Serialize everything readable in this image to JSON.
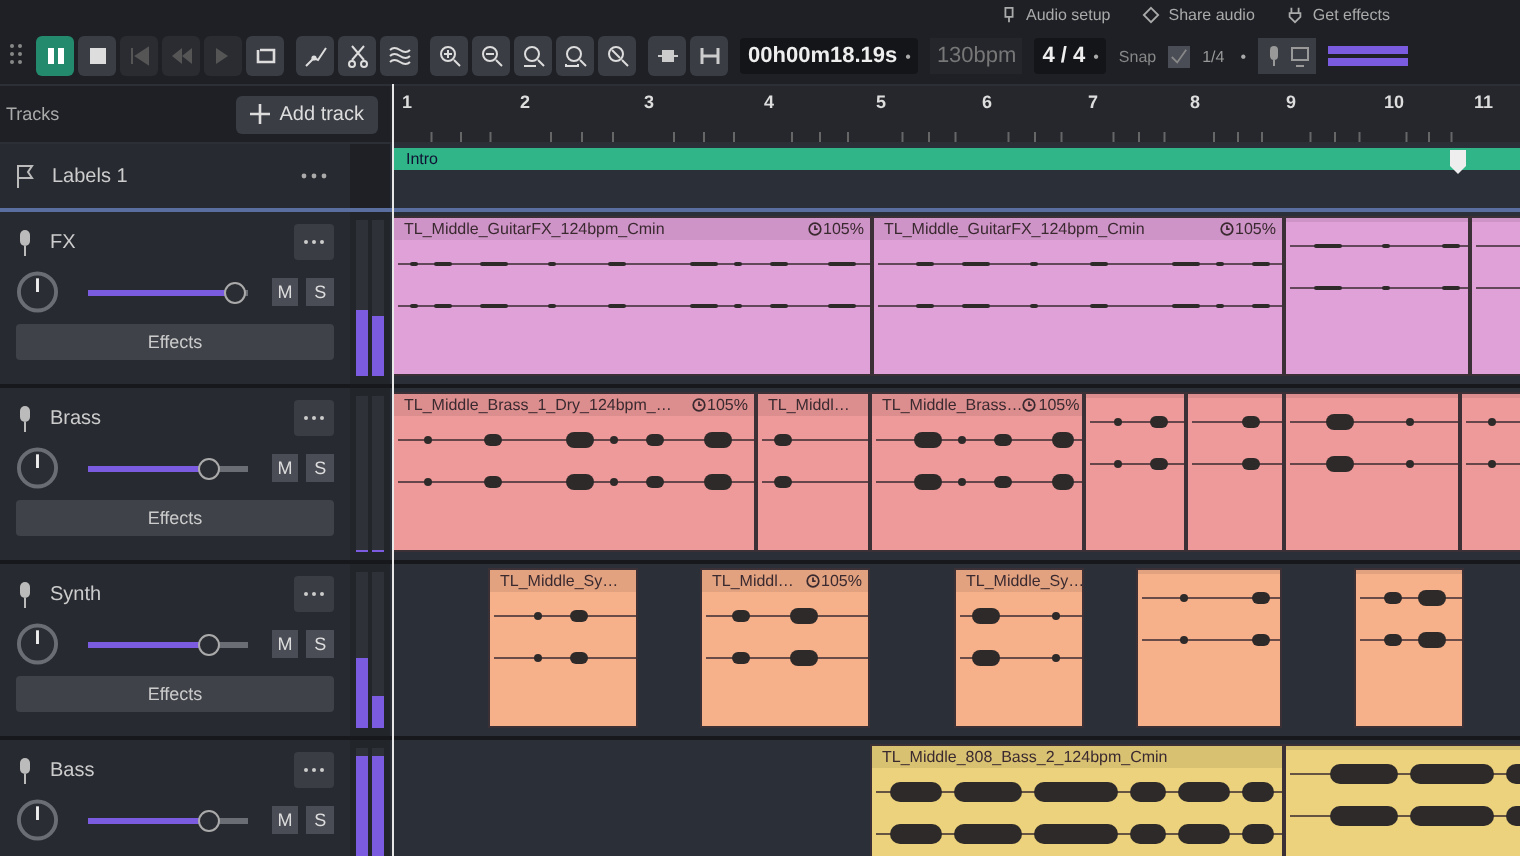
{
  "top_links": [
    {
      "kind": "setup",
      "label": "Audio setup"
    },
    {
      "kind": "share",
      "label": "Share audio"
    },
    {
      "kind": "effects",
      "label": "Get effects"
    }
  ],
  "transport": [
    {
      "kind": "pause",
      "selected": true,
      "disabled": false
    },
    {
      "kind": "stop",
      "selected": false,
      "disabled": false
    },
    {
      "kind": "rewind",
      "selected": false,
      "disabled": true
    },
    {
      "kind": "back",
      "selected": false,
      "disabled": true
    },
    {
      "kind": "forward",
      "selected": false,
      "disabled": true
    },
    {
      "kind": "loop",
      "selected": false,
      "disabled": false
    }
  ],
  "edit_tools": [
    {
      "kind": "envelope"
    },
    {
      "kind": "cut"
    },
    {
      "kind": "silence"
    }
  ],
  "zoom_tools": [
    {
      "kind": "zoom-in"
    },
    {
      "kind": "zoom-out"
    },
    {
      "kind": "zoom-fit"
    },
    {
      "kind": "zoom-selection"
    },
    {
      "kind": "zoom-toggle"
    }
  ],
  "trim_tools": [
    {
      "kind": "trim"
    },
    {
      "kind": "split"
    }
  ],
  "time": {
    "value": "00h00m18.19s",
    "caret": "•",
    "tempo": "130bpm"
  },
  "meter_signature": {
    "value": "4 / 4",
    "caret": "•"
  },
  "snap": {
    "label": "Snap",
    "checked": true,
    "value": "1/4",
    "caret": "•"
  },
  "tracks_header": {
    "title": "Tracks",
    "add_button": "Add track"
  },
  "ruler": [
    "1",
    "2",
    "3",
    "4",
    "5",
    "6",
    "7",
    "8",
    "9",
    "10",
    "11"
  ],
  "label_track": {
    "name": "Labels 1",
    "labels": [
      {
        "text": "Intro",
        "color": "#2fb587"
      }
    ]
  },
  "tracks": [
    {
      "name": "FX",
      "color": "#e0a0d8",
      "volume": {
        "level": 0.92
      },
      "mute": {
        "label": "M",
        "selected": false
      },
      "solo": {
        "label": "S",
        "selected": false
      },
      "effects": "Effects",
      "meter": [
        {
          "level": 0.42
        },
        {
          "level": 0.38
        }
      ],
      "clips": [
        {
          "kind": "audio",
          "name": "TL_Middle_GuitarFX_124bpm_Cmin",
          "stretch": "105%"
        },
        {
          "kind": "audio",
          "name": "TL_Middle_GuitarFX_124bpm_Cmin",
          "stretch": "105%"
        },
        {
          "kind": "audio"
        },
        {
          "kind": "audio"
        }
      ]
    },
    {
      "name": "Brass",
      "color": "#ef9a9a",
      "volume": {
        "level": 0.75
      },
      "mute": {
        "label": "M",
        "selected": false
      },
      "solo": {
        "label": "S",
        "selected": false
      },
      "effects": "Effects",
      "meter": [
        {
          "level": 0
        },
        {
          "level": 0
        }
      ],
      "clips": [
        {
          "kind": "audio",
          "name": "TL_Middle_Brass_1_Dry_124bpm_…",
          "stretch": "105%"
        },
        {
          "kind": "audio",
          "name": "TL_Middl…"
        },
        {
          "kind": "audio",
          "name": "TL_Middle_Brass…",
          "stretch": "105%"
        },
        {
          "kind": "audio"
        },
        {
          "kind": "audio"
        },
        {
          "kind": "audio"
        },
        {
          "kind": "audio"
        }
      ]
    },
    {
      "name": "Synth",
      "color": "#f6b08a",
      "volume": {
        "level": 0.75
      },
      "mute": {
        "label": "M",
        "selected": false
      },
      "solo": {
        "label": "S",
        "selected": false
      },
      "effects": "Effects",
      "meter": [
        {
          "level": 0.45
        },
        {
          "level": 0.2
        }
      ],
      "clips": [
        {
          "kind": "audio",
          "name": "TL_Middle_Sy…"
        },
        {
          "kind": "audio",
          "name": "TL_Middl…",
          "stretch": "105%"
        },
        {
          "kind": "audio",
          "name": "TL_Middle_Sy…"
        },
        {
          "kind": "audio"
        },
        {
          "kind": "audio"
        }
      ]
    },
    {
      "name": "Bass",
      "color": "#ecd27c",
      "volume": {
        "level": 0.75
      },
      "mute": {
        "label": "M",
        "selected": false
      },
      "solo": {
        "label": "S",
        "selected": false
      },
      "meter": [
        {
          "level": 0.95
        },
        {
          "level": 0.95
        }
      ],
      "clips": [
        {
          "kind": "audio",
          "name": "TL_Middle_808_Bass_2_124bpm_Cmin"
        },
        {
          "kind": "audio"
        }
      ]
    }
  ]
}
